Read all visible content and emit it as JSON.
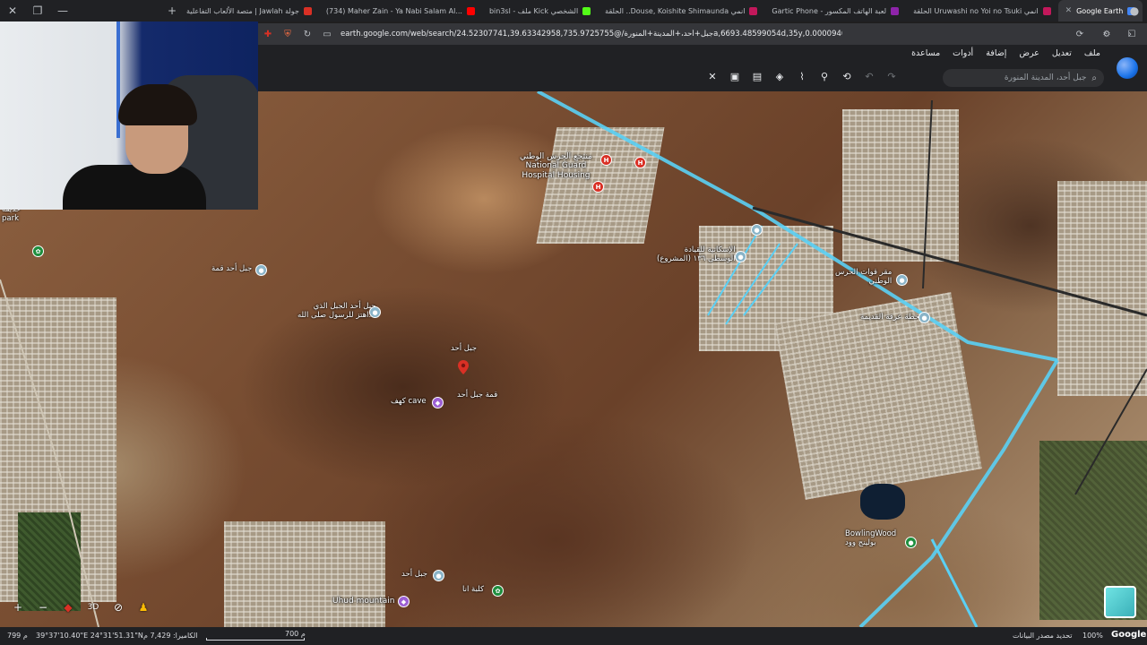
{
  "browser": {
    "tabs": [
      {
        "title": "متصة الألعاب التفاعلية | Jawlah جولة",
        "color": "#d93025"
      },
      {
        "title": "(734) Maher Zain - Ya Nabi Salam Al...",
        "color": "#ff0000"
      },
      {
        "title": "bin3sl - ملف Kick الشخصي",
        "color": "#53fc18"
      },
      {
        "title": "الحلقة ..Douse, Koishite Shimaunda انمي",
        "color": "#c2185b"
      },
      {
        "title": "Gartic Phone - لعبة الهاتف المكسور",
        "color": "#8e24aa"
      },
      {
        "title": "الحلقة Uruwashi no Yoi no Tsuki انمي",
        "color": "#c2185b"
      },
      {
        "title": "Google Earth",
        "color": "#4285f4",
        "active": true
      }
    ],
    "url": "earth.google.com/web/search/جبل+أحد،+المدينة+المنورة/@24.52307741,39.63342958,735.9725755a,6693.48599054d,35y,0.00009469h,6.03449754t..."
  },
  "earth": {
    "menus": [
      "ملف",
      "تعديل",
      "عرض",
      "إضافة",
      "أدوات",
      "مساعدة"
    ],
    "search_placeholder": "جبل أحد، المدينة المنورة",
    "tools": [
      "history-icon",
      "undo-icon",
      "redo-icon",
      "place-marker-icon",
      "path-icon",
      "layers-icon",
      "gallery-icon",
      "image-icon",
      "close-icon"
    ]
  },
  "map": {
    "labels": [
      {
        "id": "national-guard",
        "text": "منتجع الحرس الوطني\nNational Guard\nHospital Housing"
      },
      {
        "id": "jabal-uhud-top",
        "text": "جبل أحد"
      },
      {
        "id": "uhud-summit",
        "text": "قمة جبل أحد"
      },
      {
        "id": "cave",
        "text": "كهف cave"
      },
      {
        "id": "uhud-mountain",
        "text": "Uhud mountain"
      },
      {
        "id": "jabal-uhud-bottom",
        "text": "جبل أحد"
      },
      {
        "id": "kalba",
        "text": "كلبة انا"
      },
      {
        "id": "jabal-uhud-west",
        "text": "جبل أحد قمة"
      },
      {
        "id": "jabal-hadith",
        "text": "جبل أحد الجبل الذي\nاهتز للرسول صلى الله..."
      },
      {
        "id": "residential",
        "text": "الإسكانية للقيادة\nالوسطى ١٣٦ (المشروع)"
      },
      {
        "id": "guard-east",
        "text": "مقر قوات الحرس\nالوطني"
      },
      {
        "id": "old-station",
        "text": "محطة عرفة القديمة"
      },
      {
        "id": "park",
        "text": "حديقة\npark"
      },
      {
        "id": "bowling",
        "text": "BowlingWood\nبولينج وود"
      }
    ]
  },
  "status": {
    "left": "799 م",
    "coords": "39°37'10.40\"E 24°31'51.31\"N",
    "camera": "الكاميرا: 7,429 م",
    "scale": "700 م",
    "data_source": "تحديد مصدر البيانات",
    "zoom": "100%",
    "brand": "Google"
  },
  "controls": {
    "zoom_in": "+",
    "zoom_out": "−",
    "mode_3d": "3D"
  }
}
